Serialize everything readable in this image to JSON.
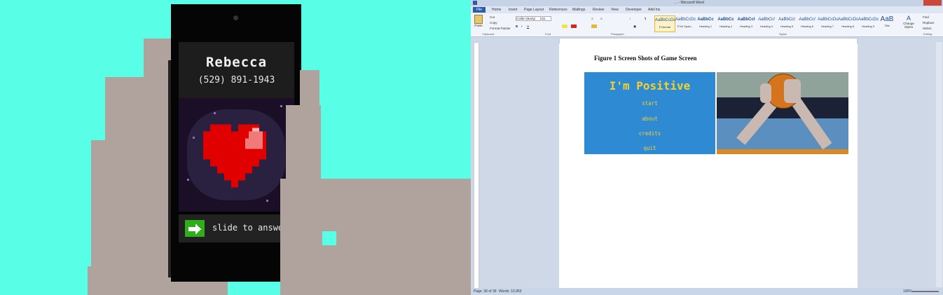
{
  "game": {
    "caller_name": "Rebecca",
    "caller_number": "(529) 891-1943",
    "slide_label": "slide to answer",
    "colors": {
      "background": "#58ffe6",
      "heart": "#e00000",
      "answer_button": "#2fae1a"
    }
  },
  "word": {
    "title": "… - Microsoft Word",
    "tabs": [
      "File",
      "Home",
      "Insert",
      "Page Layout",
      "References",
      "Mailings",
      "Review",
      "View",
      "Developer",
      "Add-Ins"
    ],
    "clipboard": {
      "paste": "Paste",
      "cut": "Cut",
      "copy": "Copy",
      "format_painter": "Format Painter",
      "group": "Clipboard"
    },
    "font": {
      "name": "Calibri (Body)",
      "size": "11",
      "group": "Font"
    },
    "paragraph_group": "Paragraph",
    "styles": [
      {
        "preview": "AaBbCcDc",
        "name": "¶ Normal"
      },
      {
        "preview": "AaBbCcDc",
        "name": "¶ No Spaci..."
      },
      {
        "preview": "AaBbCc",
        "name": "Heading 1"
      },
      {
        "preview": "AaBbCc",
        "name": "Heading 2"
      },
      {
        "preview": "AaBbCcI",
        "name": "Heading 3"
      },
      {
        "preview": "AaBbCcI",
        "name": "Heading 4"
      },
      {
        "preview": "AaBbCcI",
        "name": "Heading 5"
      },
      {
        "preview": "AaBbCcI",
        "name": "Heading 6"
      },
      {
        "preview": "AaBbCcDc",
        "name": "Heading 7"
      },
      {
        "preview": "AaBbCcDc",
        "name": "Heading 8"
      },
      {
        "preview": "AaBbCcDc",
        "name": "Heading 9"
      },
      {
        "preview": "AaB",
        "name": "Title"
      }
    ],
    "styles_group": "Styles",
    "change_styles": "Change Styles",
    "editing": {
      "find": "Find",
      "replace": "Replace",
      "select": "Select",
      "group": "Editing"
    },
    "figure_caption": "Figure 1 Screen Shots of Game Screen",
    "game_title": "I'm Positive",
    "game_menu": [
      "start",
      "about",
      "credits",
      "quit"
    ],
    "status": {
      "page": "Page: 36 of 39",
      "words": "Words: 10,953",
      "zoom": "100%"
    }
  }
}
